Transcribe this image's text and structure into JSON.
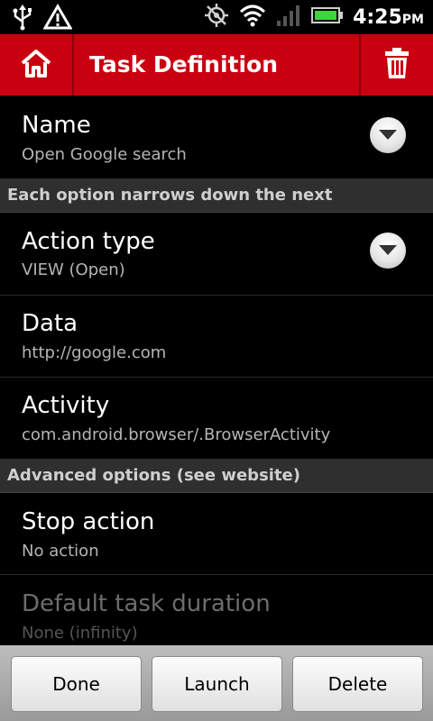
{
  "status_bar": {
    "time": "4:25",
    "ampm": "PM",
    "icons": [
      "usb-icon",
      "warning-icon",
      "gps-icon",
      "wifi-icon",
      "signal-icon",
      "battery-icon"
    ],
    "battery_color": "#3dd43d"
  },
  "action_bar": {
    "title": "Task Definition",
    "color": "#c80010"
  },
  "rows": {
    "name": {
      "label": "Name",
      "value": "Open Google search"
    },
    "action_type": {
      "label": "Action type",
      "value": "VIEW (Open)"
    },
    "data": {
      "label": "Data",
      "value": "http://google.com"
    },
    "activity": {
      "label": "Activity",
      "value": "com.android.browser/.BrowserActivity"
    },
    "stop_action": {
      "label": "Stop action",
      "value": "No action"
    },
    "default_duration": {
      "label": "Default task duration",
      "value": "None (infinity)"
    }
  },
  "sections": {
    "narrows": "Each option narrows down the next",
    "advanced": "Advanced options (see website)"
  },
  "buttons": {
    "done": "Done",
    "launch": "Launch",
    "delete": "Delete"
  }
}
